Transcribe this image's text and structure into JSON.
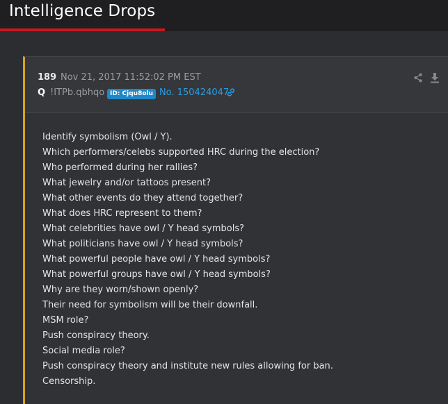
{
  "header": {
    "title": "Intelligence Drops"
  },
  "post": {
    "number": "189",
    "date": "Nov 21, 2017 11:52:02 PM EST",
    "author": "Q",
    "tripcode": "!ITPb.qbhqo",
    "id_badge": "ID: Cjqu8olu",
    "post_no": "No. 150424047",
    "lines": [
      "Identify symbolism (Owl / Y).",
      "Which performers/celebs supported HRC during the election?",
      "Who performed during her rallies?",
      "What jewelry and/or tattoos present?",
      "What other events do they attend together?",
      "What does HRC represent to them?",
      "What celebrities have owl / Y head symbols?",
      "What politicians have owl / Y head symbols?",
      "What powerful people have owl / Y head symbols?",
      "What powerful groups have owl / Y head symbols?",
      "Why are they worn/shown openly?",
      "Their need for symbolism will be their downfall.",
      "MSM role?",
      "Push conspiracy theory.",
      "Social media role?",
      "Push conspiracy theory and institute new rules allowing for ban.",
      "Censorship."
    ]
  },
  "icons": {
    "link": "link-icon",
    "share": "share-icon",
    "download": "download-icon"
  },
  "colors": {
    "accent_red": "#c8181e",
    "card_border_gold": "#d3a51a",
    "id_badge_blue": "#1e88c8",
    "link_blue": "#2a9be0"
  }
}
